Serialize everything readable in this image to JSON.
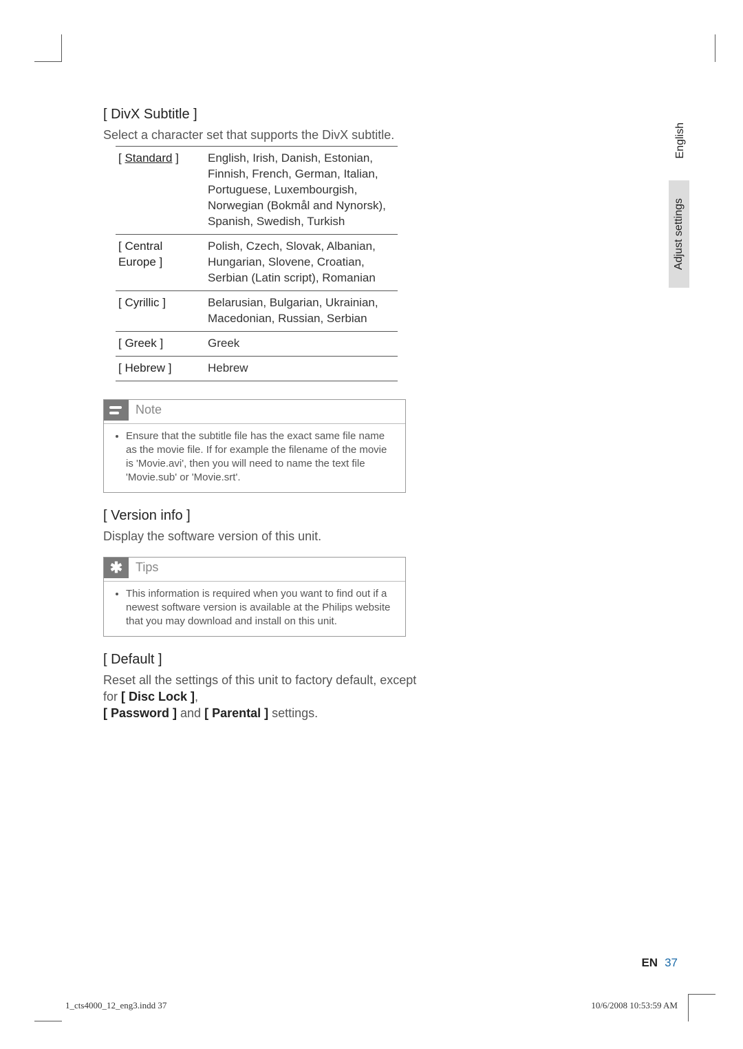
{
  "section": {
    "divx_heading": "[ DivX Subtitle ]",
    "divx_desc": "Select a character set that supports the DivX subtitle.",
    "table": {
      "rows": [
        {
          "label_prefix": "[ ",
          "label_underlined": "Standard",
          "label_suffix": " ]",
          "value": "English, Irish, Danish, Estonian, Finnish, French, German, Italian, Portuguese, Luxembourgish, Norwegian (Bokmål and Nynorsk), Spanish, Swedish, Turkish"
        },
        {
          "label": "[ Central Europe ]",
          "value": "Polish, Czech, Slovak, Albanian, Hungarian, Slovene, Croatian, Serbian (Latin script), Romanian"
        },
        {
          "label": "[ Cyrillic ]",
          "value": "Belarusian, Bulgarian, Ukrainian, Macedonian, Russian, Serbian"
        },
        {
          "label": "[ Greek ]",
          "value": "Greek"
        },
        {
          "label": "[ Hebrew ]",
          "value": "Hebrew"
        }
      ]
    },
    "note_title": "Note",
    "note_body": "Ensure that the subtitle ﬁle has the exact same ﬁle name as the movie ﬁle. If for example the ﬁlename of the movie is 'Movie.avi', then you will need to name the text ﬁle 'Movie.sub' or 'Movie.srt'.",
    "version_heading": "[ Version info ]",
    "version_desc": "Display the software version of this unit.",
    "tips_title": "Tips",
    "tips_body": "This information is required when you want to ﬁnd out if a newest software version is available at the Philips website that you may download and install on this unit.",
    "default_heading": "[ Default ]",
    "default_line1": "Reset all the settings of this unit to factory default, except for ",
    "default_disc_lock": "[ Disc Lock ]",
    "default_comma": ", ",
    "default_password": "[ Password ]",
    "default_and": " and ",
    "default_parental": "[ Parental ]",
    "default_tail": " settings."
  },
  "side": {
    "lang": "English",
    "section": "Adjust settings"
  },
  "page": {
    "label": "EN",
    "number": "37"
  },
  "footer": {
    "left": "1_cts4000_12_eng3.indd   37",
    "right": "10/6/2008   10:53:59 AM"
  }
}
